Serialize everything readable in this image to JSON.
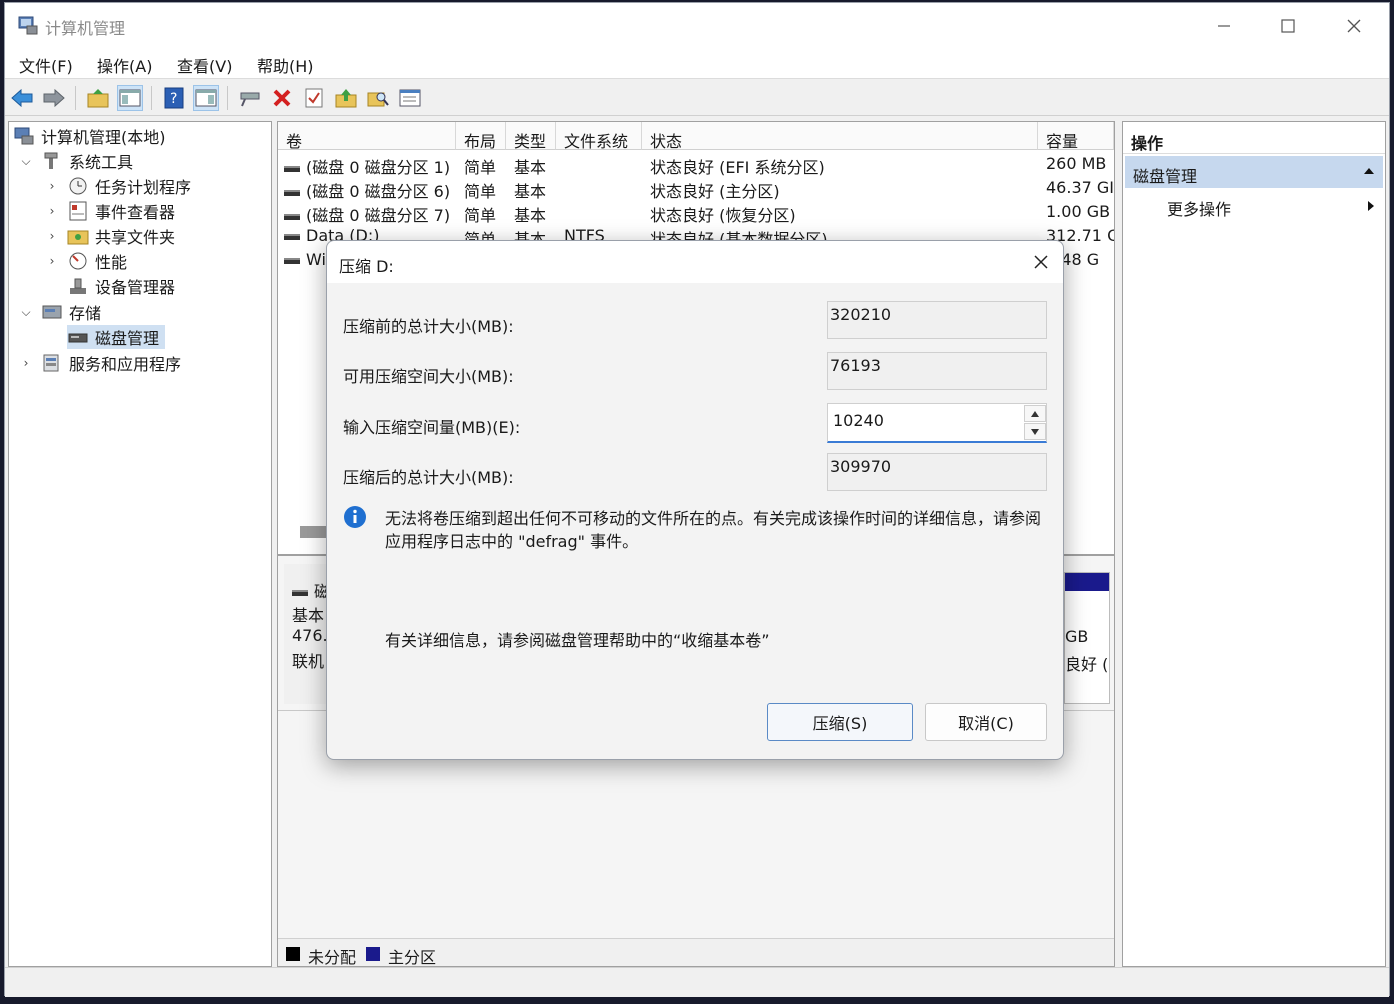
{
  "window": {
    "title": "计算机管理"
  },
  "menu": [
    "文件(F)",
    "操作(A)",
    "查看(V)",
    "帮助(H)"
  ],
  "tree": {
    "root": "计算机管理(本地)",
    "system_tools": "系统工具",
    "task_scheduler": "任务计划程序",
    "event_viewer": "事件查看器",
    "shared_folders": "共享文件夹",
    "performance": "性能",
    "device_manager": "设备管理器",
    "storage": "存储",
    "disk_management": "磁盘管理",
    "services_apps": "服务和应用程序"
  },
  "volumes": {
    "headers": [
      "卷",
      "布局",
      "类型",
      "文件系统",
      "状态",
      "容量"
    ],
    "rows": [
      {
        "vol": "(磁盘 0 磁盘分区 1)",
        "layout": "简单",
        "type": "基本",
        "fs": "",
        "status": "状态良好 (EFI 系统分区)",
        "cap": "260 MB"
      },
      {
        "vol": "(磁盘 0 磁盘分区 6)",
        "layout": "简单",
        "type": "基本",
        "fs": "",
        "status": "状态良好 (主分区)",
        "cap": "46.37 GI"
      },
      {
        "vol": "(磁盘 0 磁盘分区 7)",
        "layout": "简单",
        "type": "基本",
        "fs": "",
        "status": "状态良好 (恢复分区)",
        "cap": "1.00 GB"
      },
      {
        "vol": "Data (D:)",
        "layout": "简单",
        "type": "基本",
        "fs": "NTFS",
        "status": "状态良好 (基本数据分区)",
        "cap": "312.71 G"
      },
      {
        "vol": "Wi",
        "layout": "",
        "type": "",
        "fs": "",
        "status": "",
        "cap": "6.48 G"
      }
    ]
  },
  "disk_map": {
    "disk_label": "磁",
    "type": "基本",
    "size": "476.",
    "state": "联机",
    "right_size": "GB",
    "right_status": "良好 ("
  },
  "legend": {
    "unallocated": "未分配",
    "primary": "主分区"
  },
  "actions": {
    "title": "操作",
    "section": "磁盘管理",
    "more": "更多操作"
  },
  "dialog": {
    "title": "压缩 D:",
    "total_before_label": "压缩前的总计大小(MB):",
    "total_before_value": "320210",
    "available_label": "可用压缩空间大小(MB):",
    "available_value": "76193",
    "input_label": "输入压缩空间量(MB)(E):",
    "input_value": "10240",
    "total_after_label": "压缩后的总计大小(MB):",
    "total_after_value": "309970",
    "info_text": "无法将卷压缩到超出任何不可移动的文件所在的点。有关完成该操作时间的详细信息，请参阅应用程序日志中的 \"defrag\" 事件。",
    "help_text": "有关详细信息，请参阅磁盘管理帮助中的“收缩基本卷”",
    "shrink_button": "压缩(S)",
    "cancel_button": "取消(C)"
  },
  "colors": {
    "primary_partition": "#1a1a8c",
    "unallocated": "#000000",
    "selection": "#cfe0f2",
    "accent": "#3a7bd5"
  }
}
